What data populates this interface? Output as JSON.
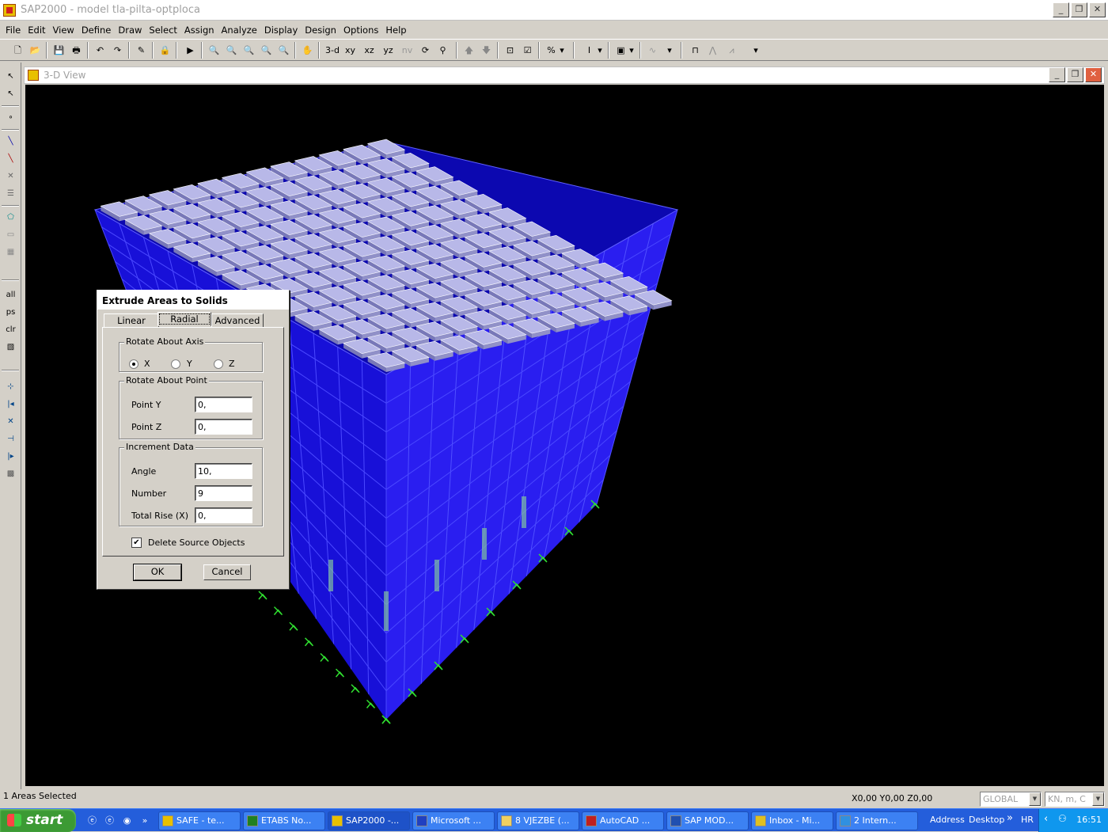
{
  "window": {
    "title": "SAP2000 - model tla-pilta-optploca"
  },
  "menu": [
    "File",
    "Edit",
    "View",
    "Define",
    "Draw",
    "Select",
    "Assign",
    "Analyze",
    "Display",
    "Design",
    "Options",
    "Help"
  ],
  "toolbar": {
    "view_3d": "3-d",
    "view_xy": "xy",
    "view_xz": "xz",
    "view_yz": "yz",
    "view_nv": "nv"
  },
  "left_toolbar": {
    "all": "all",
    "ps": "ps",
    "clr": "clr"
  },
  "view": {
    "title": "3-D View"
  },
  "dialog": {
    "title": "Extrude Areas to Solids",
    "tabs": [
      {
        "label": "Linear"
      },
      {
        "label": "Radial"
      },
      {
        "label": "Advanced"
      }
    ],
    "active_tab": "Radial",
    "rotate_axis": {
      "label": "Rotate About Axis",
      "options": [
        "X",
        "Y",
        "Z"
      ],
      "selected": "X"
    },
    "rotate_point": {
      "label": "Rotate About Point",
      "point_y_label": "Point Y",
      "point_y": "0,",
      "point_z_label": "Point Z",
      "point_z": "0,"
    },
    "increment": {
      "label": "Increment Data",
      "angle_label": "Angle",
      "angle": "10,",
      "number_label": "Number",
      "number": "9",
      "rise_label": "Total Rise (X)",
      "rise": "0,"
    },
    "delete_source": {
      "label": "Delete Source Objects",
      "checked": true
    },
    "ok_label": "OK",
    "cancel_label": "Cancel"
  },
  "status": {
    "selection": "1 Areas Selected",
    "coords": "X0,00  Y0,00  Z0,00",
    "coord_system": "GLOBAL",
    "units": "KN, m, C"
  },
  "taskbar": {
    "start_label": "start",
    "tasks": [
      "SAFE - te...",
      "ETABS No...",
      "SAP2000 -...",
      "Microsoft ...",
      "8 VJEZBE (...",
      "AutoCAD ...",
      "SAP  MOD...",
      "Inbox - Mi...",
      "2 Intern..."
    ],
    "address_label": "Address",
    "desktop_label": "Desktop",
    "lang": "HR",
    "time": "16:51"
  },
  "colors": {
    "model_blue": "#1a10e0",
    "slab_gray": "#b8b8e8",
    "support_green": "#30e030",
    "canvas_bg": "#000000"
  }
}
